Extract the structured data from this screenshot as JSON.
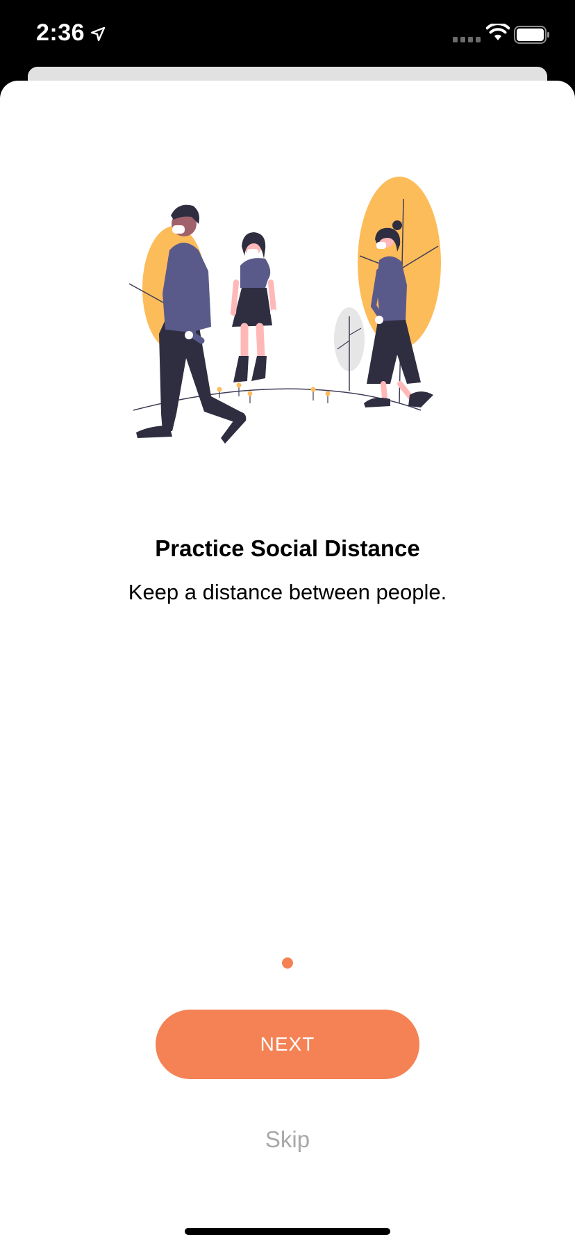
{
  "status_bar": {
    "time": "2:36",
    "icons": [
      "location-arrow-icon",
      "cellular-signal-icon",
      "wifi-icon",
      "battery-icon"
    ]
  },
  "onboarding": {
    "title": "Practice Social Distance",
    "subtitle": "Keep a distance between people.",
    "illustration": "people-walking-with-masks-illustration",
    "page_indicator": {
      "current": 1
    },
    "next_label": "NEXT",
    "skip_label": "Skip"
  },
  "colors": {
    "accent": "#f58254",
    "tree_yellow": "#fdbc5a",
    "clothing_purple": "#5a5a8a",
    "clothing_dark": "#2f2e41",
    "skip_gray": "#a8a8a8"
  }
}
